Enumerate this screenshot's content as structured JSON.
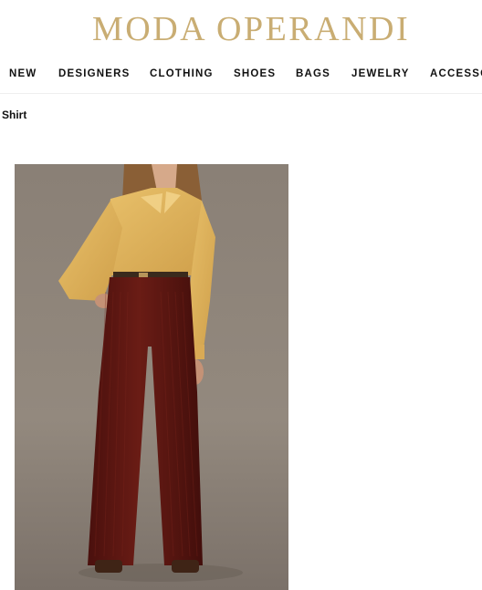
{
  "brand": {
    "name": "MODA OPERANDI"
  },
  "nav": {
    "items": [
      {
        "label": "NEW"
      },
      {
        "label": "DESIGNERS"
      },
      {
        "label": "CLOTHING"
      },
      {
        "label": "SHOES"
      },
      {
        "label": "BAGS"
      },
      {
        "label": "JEWELRY"
      },
      {
        "label": "ACCESSO"
      }
    ]
  },
  "breadcrumb": {
    "current": "Shirt"
  },
  "colors": {
    "brand_gold": "#c9ad73",
    "backdrop": "#8e847a",
    "shirt": "#e0b55e",
    "trousers": "#5e1712"
  }
}
